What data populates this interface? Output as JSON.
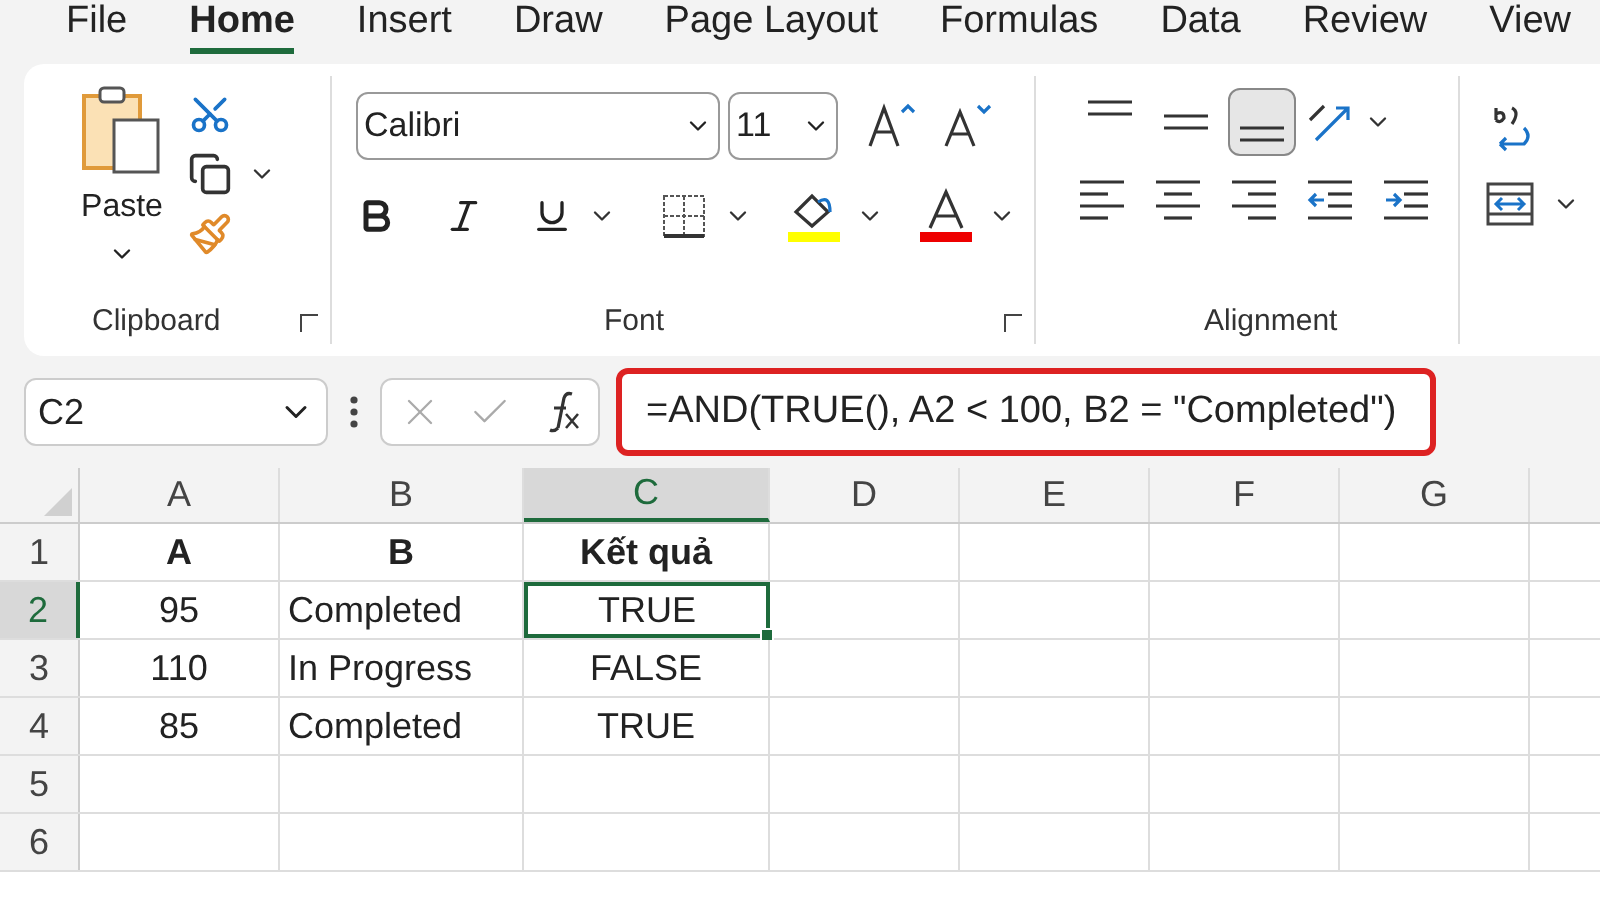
{
  "tabs": [
    {
      "label": "File",
      "selected": false
    },
    {
      "label": "Home",
      "selected": true
    },
    {
      "label": "Insert",
      "selected": false
    },
    {
      "label": "Draw",
      "selected": false
    },
    {
      "label": "Page Layout",
      "selected": false
    },
    {
      "label": "Formulas",
      "selected": false
    },
    {
      "label": "Data",
      "selected": false
    },
    {
      "label": "Review",
      "selected": false
    },
    {
      "label": "View",
      "selected": false
    }
  ],
  "clipboard": {
    "paste_label": "Paste",
    "group_label": "Clipboard"
  },
  "font": {
    "name": "Calibri",
    "size": "11",
    "group_label": "Font"
  },
  "alignment": {
    "vertical_buttons": [
      {
        "kind": "top",
        "selected": false
      },
      {
        "kind": "middle",
        "selected": false
      },
      {
        "kind": "bottom",
        "selected": true
      }
    ],
    "group_label": "Alignment"
  },
  "formula_bar": {
    "name_box": "C2",
    "formula": "=AND(TRUE(), A2 < 100, B2 = \"Completed\")"
  },
  "grid": {
    "columns": [
      {
        "label": "A",
        "selected": false
      },
      {
        "label": "B",
        "selected": false
      },
      {
        "label": "C",
        "selected": true
      },
      {
        "label": "D",
        "selected": false
      },
      {
        "label": "E",
        "selected": false
      },
      {
        "label": "F",
        "selected": false
      },
      {
        "label": "G",
        "selected": false
      }
    ],
    "rows": [
      {
        "label": "1",
        "selected": false,
        "cells": [
          {
            "text": "A",
            "selected": false,
            "bold": true,
            "kind": "header"
          },
          {
            "text": "B",
            "selected": false,
            "bold": true,
            "kind": "header"
          },
          {
            "text": "Kết quả",
            "selected": false,
            "bold": true,
            "kind": "header"
          }
        ]
      },
      {
        "label": "2",
        "selected": true,
        "cells": [
          {
            "text": "95",
            "selected": false,
            "bold": false,
            "kind": "number"
          },
          {
            "text": "Completed",
            "selected": false,
            "bold": false,
            "kind": "text"
          },
          {
            "text": "TRUE",
            "selected": true,
            "bold": false,
            "kind": "boolean"
          }
        ]
      },
      {
        "label": "3",
        "selected": false,
        "cells": [
          {
            "text": "110",
            "selected": false,
            "bold": false,
            "kind": "number"
          },
          {
            "text": "In Progress",
            "selected": false,
            "bold": false,
            "kind": "text"
          },
          {
            "text": "FALSE",
            "selected": false,
            "bold": false,
            "kind": "boolean"
          }
        ]
      },
      {
        "label": "4",
        "selected": false,
        "cells": [
          {
            "text": "85",
            "selected": false,
            "bold": false,
            "kind": "number"
          },
          {
            "text": "Completed",
            "selected": false,
            "bold": false,
            "kind": "text"
          },
          {
            "text": "TRUE",
            "selected": false,
            "bold": false,
            "kind": "boolean"
          }
        ]
      },
      {
        "label": "5",
        "selected": false,
        "cells": []
      },
      {
        "label": "6",
        "selected": false,
        "cells": []
      }
    ]
  }
}
